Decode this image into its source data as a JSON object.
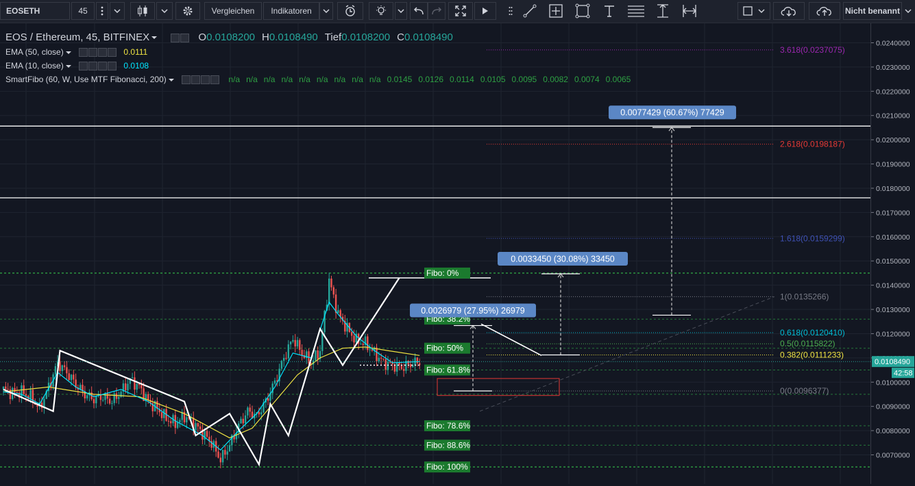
{
  "toolbar": {
    "symbol": "EOSETH",
    "interval": "45",
    "compare_label": "Vergleichen",
    "indicators_label": "Indikatoren",
    "layout_name": "Nicht benannt"
  },
  "legend": {
    "title": "EOS / Ethereum, 45, BITFINEX",
    "ohlc": [
      {
        "label": "O",
        "value": "0.0108200"
      },
      {
        "label": "H",
        "value": "0.0108490"
      },
      {
        "label": "Tief",
        "value": "0.0108200"
      },
      {
        "label": "C",
        "value": "0.0108490"
      }
    ],
    "ema50": {
      "label": "EMA (50, close)",
      "value": "0.0111",
      "color": "#f0e442"
    },
    "ema10": {
      "label": "EMA (10, close)",
      "value": "0.0108",
      "color": "#00e5ff"
    },
    "smartfibo": {
      "label": "SmartFibo (60, W, Use MTF Fibonacci, 200)",
      "values": [
        "n/a",
        "n/a",
        "n/a",
        "n/a",
        "n/a",
        "n/a",
        "n/a",
        "n/a",
        "n/a",
        "0.0145",
        "0.0126",
        "0.0114",
        "0.0105",
        "0.0095",
        "0.0082",
        "0.0074",
        "0.0065"
      ]
    }
  },
  "colors": {
    "background": "#131722",
    "grid": "#1f2430",
    "candle_up": "#26a69a",
    "candle_down": "#ef5350",
    "ema50": "#f0e442",
    "ema10": "#00e5ff",
    "fibo_label_bg": "#1b7a2e",
    "fibo_line": "#2ea043",
    "measure_bg": "#5b87c5"
  },
  "chart_data": {
    "type": "line",
    "title": "EOS / Ethereum, 45, BITFINEX",
    "ylim": [
      0.0064,
      0.0247
    ],
    "price_ticks": [
      "0.0240000",
      "0.0230000",
      "0.0220000",
      "0.0210000",
      "0.0200000",
      "0.0190000",
      "0.0180000",
      "0.0170000",
      "0.0160000",
      "0.0150000",
      "0.0140000",
      "0.0130000",
      "0.0120000",
      "0.0110000",
      "0.0100000",
      "0.0090000",
      "0.0080000",
      "0.0070000"
    ],
    "grid": true,
    "price": {
      "x": [
        0,
        4,
        8,
        12,
        16,
        20,
        24,
        28,
        32,
        36,
        40,
        44,
        48,
        52,
        56,
        60,
        64,
        68,
        72,
        76,
        80,
        84,
        88,
        92,
        96,
        100,
        104,
        108,
        112,
        116,
        120,
        124,
        128,
        132,
        136,
        140,
        144,
        148,
        152,
        156,
        160,
        164,
        168,
        172,
        176,
        180,
        184
      ],
      "y": [
        0.0097,
        0.00955,
        0.0096,
        0.0094,
        0.0089,
        0.0098,
        0.0108,
        0.0104,
        0.0099,
        0.0095,
        0.0093,
        0.0094,
        0.0092,
        0.0096,
        0.0101,
        0.0098,
        0.0092,
        0.0089,
        0.0085,
        0.0083,
        0.0086,
        0.0083,
        0.0079,
        0.0075,
        0.0068,
        0.0074,
        0.0082,
        0.0088,
        0.0086,
        0.0092,
        0.01,
        0.011,
        0.0118,
        0.0112,
        0.0108,
        0.0113,
        0.0142,
        0.0128,
        0.0122,
        0.0117,
        0.0116,
        0.0112,
        0.0108,
        0.0107,
        0.0106,
        0.01075,
        0.01085
      ]
    },
    "ema50": {
      "x": [
        0,
        20,
        40,
        60,
        80,
        100,
        110,
        120,
        130,
        140,
        150,
        160,
        170,
        184
      ],
      "y": [
        0.0096,
        0.0098,
        0.0095,
        0.0094,
        0.0087,
        0.0077,
        0.0081,
        0.0092,
        0.0103,
        0.011,
        0.0114,
        0.01145,
        0.0113,
        0.0111
      ]
    },
    "ema10": {
      "x": [
        0,
        8,
        16,
        24,
        32,
        40,
        52,
        64,
        76,
        88,
        96,
        104,
        112,
        120,
        128,
        136,
        144,
        148,
        156,
        164,
        172,
        184
      ],
      "y": [
        0.0096,
        0.0095,
        0.0091,
        0.0104,
        0.0098,
        0.0094,
        0.0097,
        0.0092,
        0.0084,
        0.0078,
        0.0072,
        0.008,
        0.0087,
        0.0098,
        0.0112,
        0.011,
        0.0133,
        0.0128,
        0.0119,
        0.0113,
        0.0108,
        0.01085
      ]
    },
    "zigzag": {
      "x": [
        0,
        22,
        25,
        80,
        85,
        100,
        113,
        118,
        126,
        140,
        150,
        175
      ],
      "y": [
        0.0097,
        0.0088,
        0.0113,
        0.0092,
        0.0078,
        0.0087,
        0.0066,
        0.0091,
        0.0078,
        0.0122,
        0.0107,
        0.0143
      ]
    },
    "horizontal_lines": [
      {
        "price": 0.0205633,
        "label": "0.0205633"
      },
      {
        "price": 0.0176042,
        "label": "0.0176042"
      }
    ],
    "current_price": {
      "label": "0.0108490",
      "timer": "42:58"
    },
    "fib_retracement": [
      {
        "label": "Fibo:   0%",
        "price": 0.0145
      },
      {
        "label": "Fibo: 38.2%",
        "price": 0.0126
      },
      {
        "label": "Fibo:  50%",
        "price": 0.0114
      },
      {
        "label": "Fibo: 61.8%",
        "price": 0.0105
      },
      {
        "label": "Fibo: 78.6%",
        "price": 0.0082
      },
      {
        "label": "Fibo: 88.6%",
        "price": 0.0074
      },
      {
        "label": "Fibo: 100%",
        "price": 0.0065
      }
    ],
    "fib_extension": [
      {
        "label": "3.618(0.0237075)",
        "price": 0.0237075,
        "color": "#9c27b0"
      },
      {
        "label": "2.618(0.0198187)",
        "price": 0.0198187,
        "color": "#e53935"
      },
      {
        "label": "1.618(0.0159299)",
        "price": 0.0159299,
        "color": "#3f51b5"
      },
      {
        "label": "1(0.0135266)",
        "price": 0.0135266,
        "color": "#787b86"
      },
      {
        "label": "0.618(0.0120410)",
        "price": 0.012041,
        "color": "#00bcd4"
      },
      {
        "label": "0.5(0.0115822)",
        "price": 0.0115822,
        "color": "#4caf50"
      },
      {
        "label": "0.382(0.0111233)",
        "price": 0.0111233,
        "color": "#f0e442"
      },
      {
        "label": "0(0.0096377)",
        "price": 0.0096377,
        "color": "#787b86"
      }
    ],
    "measurements": [
      {
        "label": "0.0026979 (27.95%) 26979",
        "from": 0.0096377,
        "to": 0.0123356
      },
      {
        "label": "0.0033450 (30.08%) 33450",
        "from": 0.0111233,
        "to": 0.0144683
      },
      {
        "label": "0.0077429 (60.67%) 77429",
        "from": 0.0127629,
        "to": 0.0205058
      }
    ]
  }
}
